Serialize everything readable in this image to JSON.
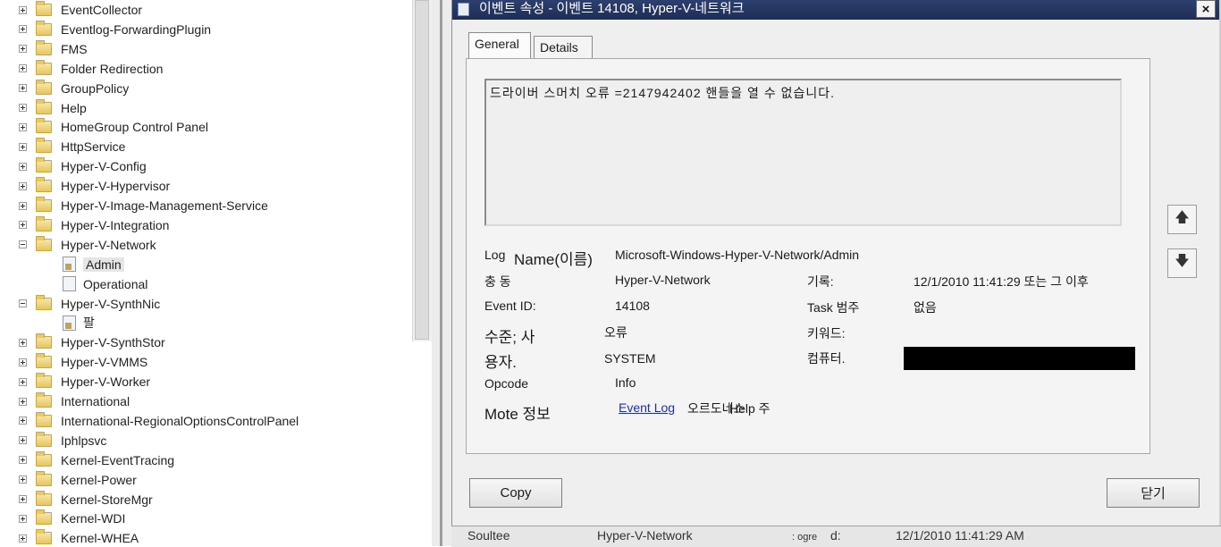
{
  "tree": {
    "items": [
      {
        "label": "EventCollector",
        "kind": "folder",
        "expanded": false
      },
      {
        "label": "Eventlog-ForwardingPlugin",
        "kind": "folder",
        "expanded": false
      },
      {
        "label": "FMS",
        "kind": "folder",
        "expanded": false
      },
      {
        "label": "Folder Redirection",
        "kind": "folder",
        "expanded": false
      },
      {
        "label": "GroupPolicy",
        "kind": "folder",
        "expanded": false
      },
      {
        "label": "Help",
        "kind": "folder",
        "expanded": false
      },
      {
        "label": "HomeGroup Control Panel",
        "kind": "folder",
        "expanded": false
      },
      {
        "label": "HttpService",
        "kind": "folder",
        "expanded": false
      },
      {
        "label": "Hyper-V-Config",
        "kind": "folder",
        "expanded": false
      },
      {
        "label": "Hyper-V-Hypervisor",
        "kind": "folder",
        "expanded": false
      },
      {
        "label": "Hyper-V-Image-Management-Service",
        "kind": "folder",
        "expanded": false
      },
      {
        "label": "Hyper-V-Integration",
        "kind": "folder",
        "expanded": false
      },
      {
        "label": "Hyper-V-Network",
        "kind": "folder",
        "expanded": true
      },
      {
        "label": "Admin",
        "kind": "log-admin",
        "selected": true
      },
      {
        "label": "Operational",
        "kind": "log"
      },
      {
        "label": "Hyper-V-SynthNic",
        "kind": "folder-noicon",
        "expanded": true
      },
      {
        "label": "팔",
        "kind": "log-admin"
      },
      {
        "label": "Hyper-V-SynthStor",
        "kind": "folder",
        "expanded": false
      },
      {
        "label": "Hyper-V-VMMS",
        "kind": "folder",
        "expanded": false
      },
      {
        "label": "Hyper-V-Worker",
        "kind": "folder",
        "expanded": false
      },
      {
        "label": "International",
        "kind": "folder",
        "expanded": false
      },
      {
        "label": "International-RegionalOptionsControlPanel",
        "kind": "folder",
        "expanded": false
      },
      {
        "label": "Iphlpsvc",
        "kind": "folder",
        "expanded": false
      },
      {
        "label": "Kernel-EventTracing",
        "kind": "folder",
        "expanded": false
      },
      {
        "label": "Kernel-Power",
        "kind": "folder",
        "expanded": false
      },
      {
        "label": "Kernel-StoreMgr",
        "kind": "folder",
        "expanded": false
      },
      {
        "label": "Kernel-WDI",
        "kind": "folder",
        "expanded": false
      },
      {
        "label": "Kernel-WHEA",
        "kind": "folder",
        "expanded": false
      }
    ]
  },
  "dialog": {
    "title": "이벤트 속성 - 이벤트 14108, Hyper-V-네트워크",
    "close_glyph": "×",
    "tabs": [
      "General",
      "Details"
    ],
    "message": "드라이버 스머치 오류 =2147942402 핸들을 열 수 없습니다.",
    "fields": {
      "log_name_label_a": "Log",
      "log_name_label_b": "Name(이름)",
      "log_name_value": "Microsoft-Windows-Hyper-V-Network/Admin",
      "source_label": "충 동",
      "source_value": "Hyper-V-Network",
      "logged_label": "기록:",
      "logged_value": "12/1/2010 11:41:29 또는 그 이후",
      "event_id_label": "Event ID:",
      "event_id_value": "14108",
      "task_label": "Task 범주",
      "task_value": "없음",
      "level_label": "수준; 사",
      "level_value": "오류",
      "keywords_label": "키워드:",
      "user_label": "용자.",
      "user_value": "SYSTEM",
      "computer_label": "컴퓨터.",
      "opcode_label": "Opcode",
      "opcode_value": "Info",
      "more_info_label": "Mote 정보",
      "more_info_link": "Event Log",
      "more_info_link_tail": "오르도네스",
      "more_info_link_overlap": "Help 주"
    },
    "up_glyph": "🡅",
    "down_glyph": "🡇",
    "copy_label": "Copy",
    "close_label": "닫기"
  },
  "bottom_strip": {
    "source_label": "Soultee",
    "source_value": "Hyper-V-Network",
    "logged_label": ": ogre",
    "logged_label_tail": "d:",
    "logged_value": "12/1/2010 11:41:29 AM"
  }
}
